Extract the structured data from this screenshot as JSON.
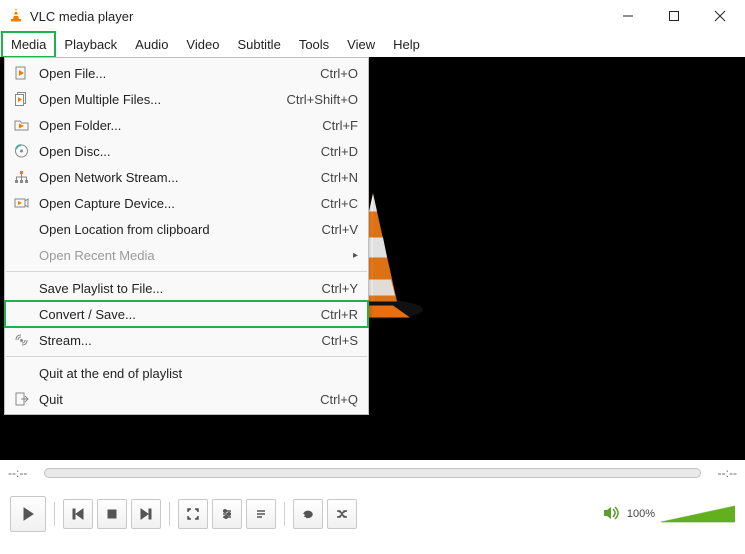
{
  "window": {
    "title": "VLC media player",
    "controls": {
      "min": "minimize-icon",
      "max": "maximize-icon",
      "close": "close-icon"
    }
  },
  "menubar": {
    "items": [
      {
        "label": "Media",
        "highlighted": true
      },
      {
        "label": "Playback",
        "highlighted": false
      },
      {
        "label": "Audio",
        "highlighted": false
      },
      {
        "label": "Video",
        "highlighted": false
      },
      {
        "label": "Subtitle",
        "highlighted": false
      },
      {
        "label": "Tools",
        "highlighted": false
      },
      {
        "label": "View",
        "highlighted": false
      },
      {
        "label": "Help",
        "highlighted": false
      }
    ]
  },
  "dropdown": {
    "items": [
      {
        "icon": "file-play-icon",
        "label": "Open File...",
        "shortcut": "Ctrl+O",
        "enabled": true,
        "highlighted": false
      },
      {
        "icon": "files-play-icon",
        "label": "Open Multiple Files...",
        "shortcut": "Ctrl+Shift+O",
        "enabled": true,
        "highlighted": false
      },
      {
        "icon": "folder-play-icon",
        "label": "Open Folder...",
        "shortcut": "Ctrl+F",
        "enabled": true,
        "highlighted": false
      },
      {
        "icon": "disc-icon",
        "label": "Open Disc...",
        "shortcut": "Ctrl+D",
        "enabled": true,
        "highlighted": false
      },
      {
        "icon": "network-icon",
        "label": "Open Network Stream...",
        "shortcut": "Ctrl+N",
        "enabled": true,
        "highlighted": false
      },
      {
        "icon": "capture-icon",
        "label": "Open Capture Device...",
        "shortcut": "Ctrl+C",
        "enabled": true,
        "highlighted": false
      },
      {
        "icon": "",
        "label": "Open Location from clipboard",
        "shortcut": "Ctrl+V",
        "enabled": true,
        "highlighted": false
      },
      {
        "icon": "",
        "label": "Open Recent Media",
        "shortcut": "",
        "enabled": false,
        "highlighted": false,
        "submenu": true
      },
      {
        "sep": true
      },
      {
        "icon": "",
        "label": "Save Playlist to File...",
        "shortcut": "Ctrl+Y",
        "enabled": true,
        "highlighted": false
      },
      {
        "icon": "",
        "label": "Convert / Save...",
        "shortcut": "Ctrl+R",
        "enabled": true,
        "highlighted": true
      },
      {
        "icon": "stream-icon",
        "label": "Stream...",
        "shortcut": "Ctrl+S",
        "enabled": true,
        "highlighted": false
      },
      {
        "sep": true
      },
      {
        "icon": "",
        "label": "Quit at the end of playlist",
        "shortcut": "",
        "enabled": true,
        "highlighted": false
      },
      {
        "icon": "quit-icon",
        "label": "Quit",
        "shortcut": "Ctrl+Q",
        "enabled": true,
        "highlighted": false
      }
    ]
  },
  "seek": {
    "elapsed": "--:--",
    "total": "--:--"
  },
  "status": {
    "volume_pct": "100%"
  },
  "player_controls": {
    "play": "play-icon",
    "prev": "previous-icon",
    "stop": "stop-icon",
    "next": "next-icon",
    "fullscreen": "fullscreen-icon",
    "extended": "settings-icon",
    "playlist": "playlist-icon",
    "loop": "loop-icon",
    "shuffle": "shuffle-icon",
    "mute": "speaker-icon"
  }
}
